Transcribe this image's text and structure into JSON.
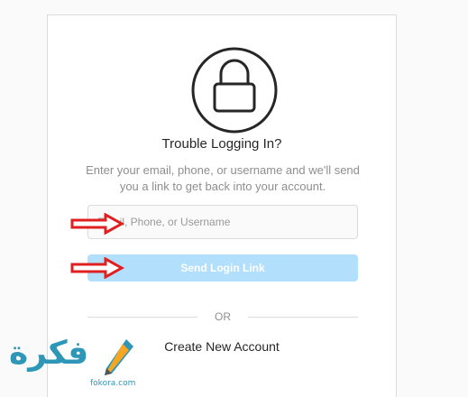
{
  "reset": {
    "title": "Trouble Logging In?",
    "description": "Enter your email, phone, or username and we'll send you a link to get back into your account.",
    "input_placeholder": "Email, Phone, or Username",
    "send_button": "Send Login Link",
    "divider_text": "OR",
    "create_account": "Create New Account"
  },
  "watermark": {
    "logo_text": "فكرة",
    "domain": "fokora.com"
  },
  "colors": {
    "button_bg": "#b2dffc",
    "arrow_red": "#e02020",
    "watermark_blue": "#2e97b8"
  },
  "icons": {
    "lock": "lock-icon",
    "arrow": "arrow-right-icon",
    "pencil": "pencil-icon"
  }
}
